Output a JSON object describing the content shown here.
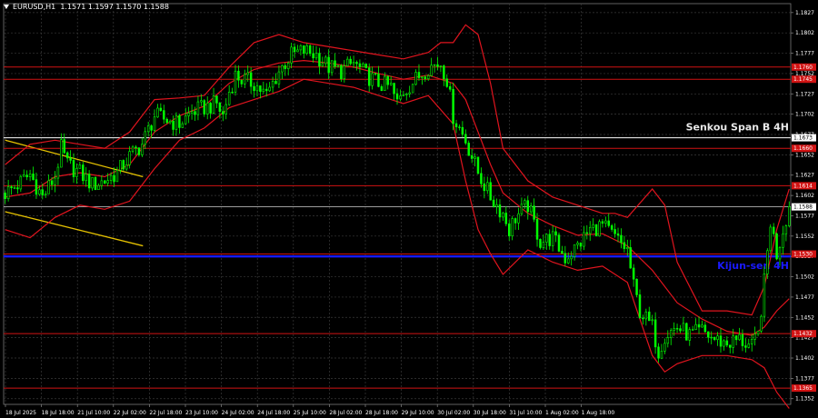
{
  "header": {
    "symbol": "EURUSD,H1",
    "ohlc": "1.1571 1.1597 1.1570 1.1588"
  },
  "colors": {
    "background": "#000000",
    "grid": "#3a3a3a",
    "candle": "#00ff00",
    "bollinger": "#e0141e",
    "level": "#d11313",
    "kijun": "#1a1aff",
    "senkou": "#ffffff",
    "trendline": "#e6c200",
    "text": "#ffffff"
  },
  "chart_data": {
    "type": "candlestick",
    "ylim": [
      1.1345,
      1.1838
    ],
    "y_ticks": [
      "1.1827",
      "1.1802",
      "1.1777",
      "1.1752",
      "1.1727",
      "1.1702",
      "1.1677",
      "1.1652",
      "1.1627",
      "1.1602",
      "1.1577",
      "1.1552",
      "1.1527",
      "1.1502",
      "1.1477",
      "1.1452",
      "1.1427",
      "1.1402",
      "1.1377",
      "1.1352"
    ],
    "x_ticks": [
      "18 Jul 2025",
      "18 Jul 18:00",
      "21 Jul 10:00",
      "22 Jul 02:00",
      "22 Jul 18:00",
      "23 Jul 10:00",
      "24 Jul 02:00",
      "24 Jul 18:00",
      "25 Jul 10:00",
      "28 Jul 02:00",
      "28 Jul 18:00",
      "29 Jul 10:00",
      "30 Jul 02:00",
      "30 Jul 18:00",
      "31 Jul 10:00",
      "1 Aug 02:00",
      "1 Aug 18:00"
    ],
    "close_path": [
      [
        0,
        1.1605
      ],
      [
        4,
        1.1615
      ],
      [
        8,
        1.1628
      ],
      [
        12,
        1.16
      ],
      [
        16,
        1.1625
      ],
      [
        18,
        1.166
      ],
      [
        20,
        1.164
      ],
      [
        24,
        1.163
      ],
      [
        28,
        1.1615
      ],
      [
        32,
        1.162
      ],
      [
        36,
        1.163
      ],
      [
        40,
        1.165
      ],
      [
        44,
        1.1665
      ],
      [
        48,
        1.17
      ],
      [
        52,
        1.1695
      ],
      [
        56,
        1.169
      ],
      [
        60,
        1.1705
      ],
      [
        64,
        1.171
      ],
      [
        68,
        1.1715
      ],
      [
        70,
        1.17
      ],
      [
        72,
        1.173
      ],
      [
        74,
        1.175
      ],
      [
        76,
        1.1745
      ],
      [
        80,
        1.174
      ],
      [
        84,
        1.1725
      ],
      [
        88,
        1.1755
      ],
      [
        92,
        1.1775
      ],
      [
        96,
        1.178
      ],
      [
        100,
        1.1775
      ],
      [
        104,
        1.176
      ],
      [
        108,
        1.1755
      ],
      [
        112,
        1.1765
      ],
      [
        116,
        1.175
      ],
      [
        120,
        1.174
      ],
      [
        124,
        1.1735
      ],
      [
        126,
        1.1715
      ],
      [
        128,
        1.173
      ],
      [
        132,
        1.1745
      ],
      [
        136,
        1.176
      ],
      [
        140,
        1.1765
      ],
      [
        142,
        1.1745
      ],
      [
        144,
        1.17
      ],
      [
        148,
        1.167
      ],
      [
        152,
        1.163
      ],
      [
        156,
        1.16
      ],
      [
        160,
        1.158
      ],
      [
        162,
        1.156
      ],
      [
        164,
        1.1575
      ],
      [
        168,
        1.159
      ],
      [
        172,
        1.1545
      ],
      [
        176,
        1.155
      ],
      [
        180,
        1.1525
      ],
      [
        184,
        1.154
      ],
      [
        188,
        1.156
      ],
      [
        192,
        1.1565
      ],
      [
        196,
        1.155
      ],
      [
        200,
        1.1535
      ],
      [
        202,
        1.149
      ],
      [
        204,
        1.146
      ],
      [
        208,
        1.144
      ],
      [
        210,
        1.141
      ],
      [
        212,
        1.143
      ],
      [
        216,
        1.144
      ],
      [
        220,
        1.143
      ],
      [
        224,
        1.1435
      ],
      [
        228,
        1.1425
      ],
      [
        232,
        1.142
      ],
      [
        236,
        1.1425
      ],
      [
        240,
        1.1415
      ],
      [
        242,
        1.143
      ],
      [
        244,
        1.1495
      ],
      [
        246,
        1.157
      ],
      [
        248,
        1.153
      ],
      [
        250,
        1.156
      ],
      [
        252,
        1.1588
      ]
    ],
    "bollinger_upper": [
      [
        0,
        1.164
      ],
      [
        8,
        1.1665
      ],
      [
        16,
        1.167
      ],
      [
        24,
        1.1665
      ],
      [
        32,
        1.166
      ],
      [
        40,
        1.168
      ],
      [
        48,
        1.172
      ],
      [
        56,
        1.1722
      ],
      [
        64,
        1.1725
      ],
      [
        72,
        1.176
      ],
      [
        80,
        1.179
      ],
      [
        88,
        1.18
      ],
      [
        96,
        1.179
      ],
      [
        104,
        1.1785
      ],
      [
        112,
        1.178
      ],
      [
        120,
        1.1775
      ],
      [
        128,
        1.177
      ],
      [
        136,
        1.1778
      ],
      [
        140,
        1.179
      ],
      [
        144,
        1.179
      ],
      [
        148,
        1.1812
      ],
      [
        152,
        1.18
      ],
      [
        156,
        1.174
      ],
      [
        160,
        1.166
      ],
      [
        168,
        1.162
      ],
      [
        176,
        1.16
      ],
      [
        184,
        1.159
      ],
      [
        192,
        1.158
      ],
      [
        196,
        1.158
      ],
      [
        200,
        1.1575
      ],
      [
        208,
        1.161
      ],
      [
        212,
        1.159
      ],
      [
        216,
        1.152
      ],
      [
        224,
        1.146
      ],
      [
        232,
        1.146
      ],
      [
        240,
        1.1455
      ],
      [
        244,
        1.149
      ],
      [
        248,
        1.156
      ],
      [
        252,
        1.161
      ]
    ],
    "bollinger_middle": [
      [
        0,
        1.16
      ],
      [
        8,
        1.1605
      ],
      [
        16,
        1.1625
      ],
      [
        24,
        1.163
      ],
      [
        32,
        1.1625
      ],
      [
        40,
        1.164
      ],
      [
        48,
        1.168
      ],
      [
        56,
        1.17
      ],
      [
        64,
        1.1712
      ],
      [
        72,
        1.174
      ],
      [
        80,
        1.1757
      ],
      [
        88,
        1.1765
      ],
      [
        96,
        1.1768
      ],
      [
        104,
        1.1765
      ],
      [
        112,
        1.176
      ],
      [
        120,
        1.1752
      ],
      [
        128,
        1.1745
      ],
      [
        136,
        1.175
      ],
      [
        144,
        1.174
      ],
      [
        148,
        1.172
      ],
      [
        152,
        1.168
      ],
      [
        156,
        1.164
      ],
      [
        160,
        1.1605
      ],
      [
        168,
        1.158
      ],
      [
        176,
        1.1565
      ],
      [
        184,
        1.1553
      ],
      [
        192,
        1.1555
      ],
      [
        200,
        1.154
      ],
      [
        208,
        1.151
      ],
      [
        216,
        1.147
      ],
      [
        224,
        1.145
      ],
      [
        232,
        1.1435
      ],
      [
        240,
        1.143
      ],
      [
        244,
        1.144
      ],
      [
        248,
        1.146
      ],
      [
        252,
        1.1475
      ]
    ],
    "bollinger_lower": [
      [
        0,
        1.156
      ],
      [
        8,
        1.155
      ],
      [
        16,
        1.1575
      ],
      [
        24,
        1.159
      ],
      [
        32,
        1.1585
      ],
      [
        40,
        1.1595
      ],
      [
        48,
        1.1635
      ],
      [
        56,
        1.167
      ],
      [
        64,
        1.1685
      ],
      [
        72,
        1.171
      ],
      [
        80,
        1.172
      ],
      [
        88,
        1.173
      ],
      [
        96,
        1.1745
      ],
      [
        104,
        1.174
      ],
      [
        112,
        1.1735
      ],
      [
        120,
        1.1725
      ],
      [
        128,
        1.1715
      ],
      [
        136,
        1.1725
      ],
      [
        144,
        1.169
      ],
      [
        148,
        1.162
      ],
      [
        152,
        1.156
      ],
      [
        156,
        1.153
      ],
      [
        160,
        1.1505
      ],
      [
        168,
        1.1535
      ],
      [
        176,
        1.152
      ],
      [
        184,
        1.151
      ],
      [
        192,
        1.1515
      ],
      [
        200,
        1.1495
      ],
      [
        208,
        1.1405
      ],
      [
        212,
        1.1385
      ],
      [
        216,
        1.1395
      ],
      [
        224,
        1.1405
      ],
      [
        232,
        1.1405
      ],
      [
        240,
        1.14
      ],
      [
        244,
        1.139
      ],
      [
        248,
        1.136
      ],
      [
        252,
        1.134
      ]
    ],
    "horizontal_levels": [
      {
        "kind": "resistance",
        "price": 1.176,
        "label": "1.1760"
      },
      {
        "kind": "resistance",
        "price": 1.1745,
        "label": "1.1745"
      },
      {
        "kind": "resistance",
        "price": 1.166,
        "label": "1.1660"
      },
      {
        "kind": "resistance",
        "price": 1.1614,
        "label": "1.1614"
      },
      {
        "kind": "resistance",
        "price": 1.153,
        "label": "1.1530"
      },
      {
        "kind": "resistance",
        "price": 1.1432,
        "label": "1.1432"
      },
      {
        "kind": "resistance",
        "price": 1.1365,
        "label": "1.1365"
      }
    ],
    "senkou": {
      "price": 1.1673,
      "price_label": "1.1673",
      "label": "Senkou Span B 4H"
    },
    "kijun": {
      "price": 1.1527,
      "label": "Kijun-sen 4H"
    },
    "current_price": {
      "price": 1.1588,
      "label": "1.1588"
    },
    "trendlines": [
      {
        "from": [
          0,
          1.167
        ],
        "to": [
          44,
          1.1625
        ]
      },
      {
        "from": [
          0,
          1.1582
        ],
        "to": [
          44,
          1.154
        ]
      }
    ],
    "bar_count": 253
  }
}
